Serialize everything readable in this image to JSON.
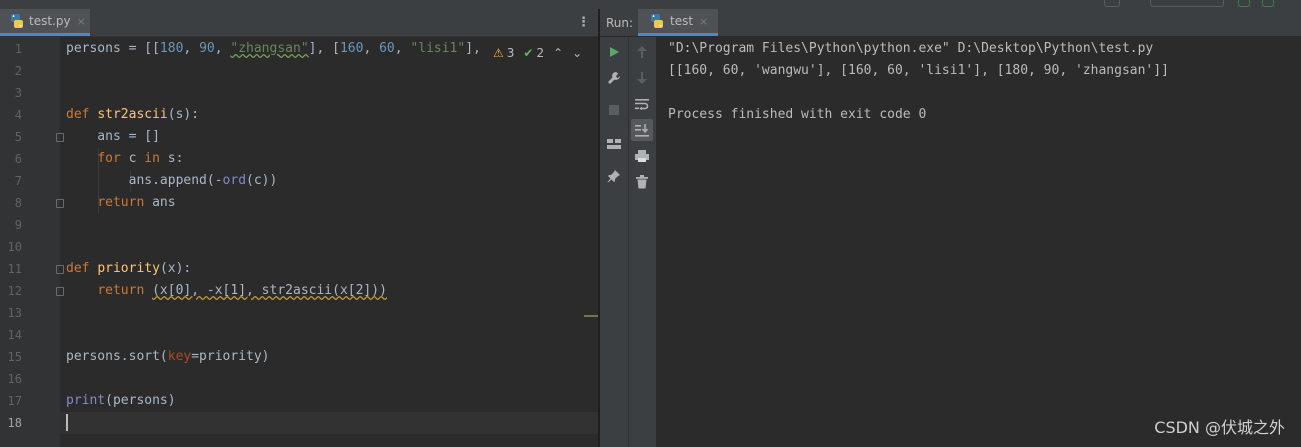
{
  "editor": {
    "tab_label": "test.py",
    "tab_close": "×",
    "menu_glyph": "⋮",
    "inspection": {
      "warnings": "3",
      "weak_warnings": "2"
    },
    "line_numbers": [
      "1",
      "2",
      "3",
      "4",
      "5",
      "6",
      "7",
      "8",
      "9",
      "10",
      "11",
      "12",
      "13",
      "14",
      "15",
      "16",
      "17",
      "18"
    ],
    "code": {
      "l1": {
        "a": "persons = [[",
        "n1": "180",
        "c1": ", ",
        "n2": "90",
        "c2": ", ",
        "s1": "\"zhangsan\"",
        "c3": "], [",
        "n3": "160",
        "c4": ", ",
        "n4": "60",
        "c5": ", ",
        "s2": "\"lisi1\"",
        "c6": "],"
      },
      "l4": {
        "kw": "def ",
        "fn": "str2ascii",
        "rest": "(s):"
      },
      "l5": {
        "text": "    ans = []"
      },
      "l6": {
        "pre": "    ",
        "kw1": "for",
        "mid": " c ",
        "kw2": "in",
        "rest": " s:"
      },
      "l7": {
        "pre": "        ans.append(-",
        "bi": "ord",
        "rest": "(c))"
      },
      "l8": {
        "pre": "    ",
        "kw": "return",
        "rest": " ans"
      },
      "l11": {
        "kw": "def ",
        "fn": "priority",
        "rest": "(x):"
      },
      "l12": {
        "pre": "    ",
        "kw": "return",
        "sp": " ",
        "u": "(x[0], -x[1], str2ascii(x[2]))"
      },
      "l15": {
        "a": "persons.sort(",
        "kwarg": "key",
        "rest": "=priority)"
      },
      "l17": {
        "bi": "print",
        "rest": "(persons)"
      }
    }
  },
  "run": {
    "label": "Run:",
    "tab_label": "test",
    "tab_close": "×",
    "output": [
      "\"D:\\Program Files\\Python\\python.exe\" D:\\Desktop\\Python\\test.py",
      "[[160, 60, 'wangwu'], [160, 60, 'lisi1'], [180, 90, 'zhangsan']]",
      "",
      "Process finished with exit code 0"
    ],
    "toolbar_left": [
      "run-icon",
      "wrench-icon",
      "stop-icon",
      "layout-icon",
      "pin-icon"
    ],
    "toolbar_right": [
      "up-arrow-icon",
      "down-arrow-icon",
      "soft-wrap-icon",
      "scroll-to-end-icon",
      "print-icon",
      "trash-icon"
    ]
  },
  "watermark": "CSDN @伏城之外",
  "colors": {
    "keyword": "#cc7832",
    "function": "#ffc66d",
    "number": "#6897bb",
    "string": "#6a8759",
    "builtin": "#8888c6",
    "kwarg": "#aa4926",
    "text": "#a9b7c6",
    "background": "#2b2b2b",
    "run_green": "#59a869"
  }
}
